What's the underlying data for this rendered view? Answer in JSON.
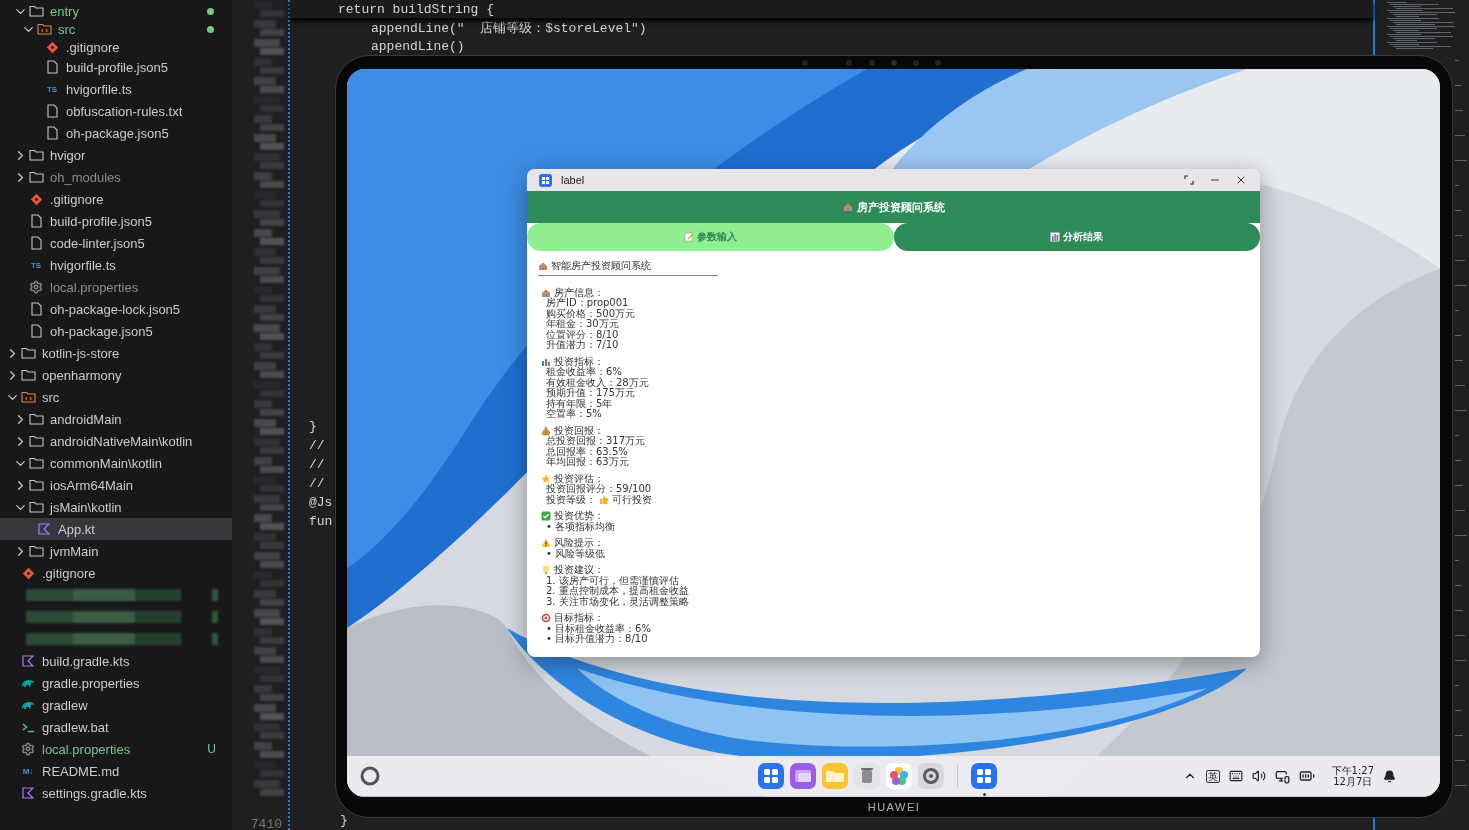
{
  "sidebar": {
    "scrolled_items": [
      {
        "name": "entry",
        "kind": "folder",
        "expanded": true,
        "modified": true,
        "selected": false,
        "children": [
          {
            "name": "src",
            "kind": "source-folder",
            "expanded": true,
            "modified": true,
            "selected": false,
            "children": [
              {
                "name": ".gitignore",
                "kind": "git",
                "selected": false
              },
              {
                "name": "build-profile.json5",
                "kind": "file",
                "selected": false
              },
              {
                "name": "hvigorfile.ts",
                "kind": "typed",
                "icon_text": "TS",
                "selected": false
              },
              {
                "name": "obfuscation-rules.txt",
                "kind": "file",
                "selected": false
              },
              {
                "name": "oh-package.json5",
                "kind": "file",
                "selected": false
              }
            ]
          }
        ]
      },
      {
        "name": "hvigor",
        "kind": "folder",
        "expanded": false,
        "selected": false
      },
      {
        "name": "oh_modules",
        "kind": "folder",
        "expanded": false,
        "ignored": true,
        "selected": false
      },
      {
        "name": ".gitignore",
        "kind": "git",
        "selected": false
      },
      {
        "name": "build-profile.json5",
        "kind": "file",
        "selected": false
      },
      {
        "name": "code-linter.json5",
        "kind": "file",
        "selected": false
      },
      {
        "name": "hvigorfile.ts",
        "kind": "typed",
        "icon_text": "TS",
        "selected": false
      },
      {
        "name": "local.properties",
        "kind": "gear",
        "ignored": true,
        "selected": false
      },
      {
        "name": "oh-package-lock.json5",
        "kind": "file",
        "selected": false
      },
      {
        "name": "oh-package.json5",
        "kind": "file",
        "selected": false
      }
    ],
    "items": [
      {
        "name": "kotlin-js-store",
        "kind": "folder",
        "expanded": false,
        "selected": false
      },
      {
        "name": "openharmony",
        "kind": "folder",
        "expanded": false,
        "selected": false
      },
      {
        "name": "src",
        "kind": "source-folder",
        "expanded": true,
        "selected": false,
        "children": [
          {
            "name": "androidMain",
            "kind": "folder",
            "expanded": false,
            "selected": false
          },
          {
            "name": "androidNativeMain\\kotlin",
            "kind": "folder",
            "expanded": false,
            "selected": false
          },
          {
            "name": "commonMain\\kotlin",
            "kind": "folder",
            "expanded": true,
            "selected": false
          },
          {
            "name": "iosArm64Main",
            "kind": "folder",
            "expanded": false,
            "selected": false
          },
          {
            "name": "jsMain\\kotlin",
            "kind": "folder",
            "expanded": true,
            "selected": false,
            "children": [
              {
                "name": "App.kt",
                "kind": "kotlin",
                "selected": true
              }
            ]
          },
          {
            "name": "jvmMain",
            "kind": "folder",
            "expanded": false,
            "selected": false
          }
        ]
      },
      {
        "name": ".gitignore",
        "kind": "git",
        "selected": false
      },
      {
        "kind": "redacted"
      },
      {
        "kind": "redacted"
      },
      {
        "kind": "redacted"
      },
      {
        "name": "build.gradle.kts",
        "kind": "kotlin",
        "selected": false
      },
      {
        "name": "gradle.properties",
        "kind": "gradle",
        "selected": false
      },
      {
        "name": "gradlew",
        "kind": "gradle",
        "selected": false
      },
      {
        "name": "gradlew.bat",
        "kind": "terminal",
        "selected": false
      },
      {
        "name": "local.properties",
        "kind": "gear",
        "git_badge": "U",
        "selected": false
      },
      {
        "name": "README.md",
        "kind": "typed",
        "icon_text": "M↓",
        "selected": false
      },
      {
        "name": "settings.gradle.kts",
        "kind": "kotlin",
        "selected": false
      }
    ]
  },
  "editor": {
    "sticky_line": "return buildString {",
    "top_lines": [
      "appendLine(\"  店铺等级：$storeLevel\")",
      "appendLine()"
    ],
    "side_lines": [
      "}",
      "//",
      "//",
      "//",
      "@Js",
      "fun"
    ],
    "bottom_line": "}",
    "bottom_line_number": "7410"
  },
  "device": {
    "brand": "HUAWEI"
  },
  "app_window": {
    "title": "label",
    "header": "房产投资顾问系统",
    "tabs": [
      {
        "label": "参数输入",
        "kind": "input",
        "selected": false
      },
      {
        "label": "分析结果",
        "kind": "results",
        "selected": true
      }
    ],
    "report": {
      "title": "智能房产投资顾问系统",
      "sections": [
        {
          "kind": "info",
          "heading": "房产信息：",
          "lines": [
            {
              "text": "房产ID：prop001"
            },
            {
              "text": "购买价格：500万元"
            },
            {
              "text": "年租金：30万元"
            },
            {
              "text": "位置评分：8/10"
            },
            {
              "text": "升值潜力：7/10"
            }
          ]
        },
        {
          "kind": "metrics",
          "heading": "投资指标：",
          "lines": [
            {
              "text": "租金收益率：6%"
            },
            {
              "text": "有效租金收入：28万元"
            },
            {
              "text": "预期升值：175万元"
            },
            {
              "text": "持有年限：5年"
            },
            {
              "text": "空置率：5%"
            }
          ]
        },
        {
          "kind": "return",
          "heading": "投资回报：",
          "lines": [
            {
              "text": "总投资回报：317万元"
            },
            {
              "text": "总回报率：63.5%"
            },
            {
              "text": "年均回报：63万元"
            }
          ]
        },
        {
          "kind": "rating",
          "heading": "投资评估：",
          "lines": [
            {
              "text": "投资回报评分：59/100"
            },
            {
              "text": "投资等级：",
              "tag": "可行投资"
            }
          ]
        },
        {
          "kind": "strengths",
          "heading": "投资优势：",
          "lines": [
            {
              "text": "•  各项指标均衡"
            }
          ]
        },
        {
          "kind": "risks",
          "heading": "风险提示：",
          "lines": [
            {
              "text": "•  风险等级低"
            }
          ]
        },
        {
          "kind": "advice",
          "heading": "投资建议：",
          "lines": [
            {
              "text": "1. 该房产可行，但需谨慎评估"
            },
            {
              "text": "2. 重点控制成本，提高租金收益"
            },
            {
              "text": "3. 关注市场变化，灵活调整策略"
            }
          ]
        },
        {
          "kind": "targets",
          "heading": "目标指标：",
          "lines": [
            {
              "text": "•  目标租金收益率：6%"
            },
            {
              "text": "•  目标升值潜力：8/10"
            }
          ]
        }
      ]
    }
  },
  "taskbar": {
    "apps": [
      {
        "kind": "grid"
      },
      {
        "kind": "cards"
      },
      {
        "kind": "folder"
      },
      {
        "kind": "trash"
      },
      {
        "kind": "flower"
      },
      {
        "kind": "gear"
      }
    ],
    "open_apps": [
      {
        "kind": "grid",
        "running": true
      }
    ],
    "input_method": "英",
    "time": "下午1:27",
    "date": "12月7日"
  }
}
